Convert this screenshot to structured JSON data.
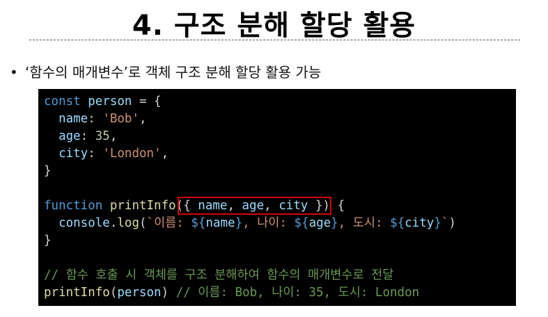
{
  "slide": {
    "title": "4. 구조 분해 할당 활용",
    "bullet": "‘함수의 매개변수’로 객체 구조 분해 할당 활용 가능"
  },
  "code": {
    "l1": {
      "a": "const",
      "b": " ",
      "c": "person",
      "d": " = {"
    },
    "l2": {
      "indent": "  ",
      "key": "name",
      "colon": ": ",
      "val": "'Bob'",
      "end": ","
    },
    "l3": {
      "indent": "  ",
      "key": "age",
      "colon": ": ",
      "val": "35",
      "end": ","
    },
    "l4": {
      "indent": "  ",
      "key": "city",
      "colon": ": ",
      "val": "'London'",
      "end": ","
    },
    "l5": "}",
    "l7": {
      "kw": "function",
      "sp": " ",
      "fn": "printInfo",
      "open": "({ ",
      "p1": "name",
      "c1": ", ",
      "p2": "age",
      "c2": ", ",
      "p3": "city",
      "close": " }) {"
    },
    "l8": {
      "indent": "  ",
      "obj": "console",
      "dot": ".",
      "fn": "log",
      "paren": "(",
      "s1": "`이름: ",
      "i1o": "${",
      "v1": "name",
      "i1c": "}",
      "s2": ", 나이: ",
      "i2o": "${",
      "v2": "age",
      "i2c": "}",
      "s3": ", 도시: ",
      "i3o": "${",
      "v3": "city",
      "i3c": "}",
      "s4": "`",
      "end": ")"
    },
    "l9": "}",
    "l11": "// 함수 호출 시 객체를 구조 분해하여 함수의 매개변수로 전달",
    "l12": {
      "fn": "printInfo",
      "open": "(",
      "arg": "person",
      "close": ")",
      "sp": " ",
      "comment": "// 이름: Bob, 나이: 35, 도시: London"
    }
  },
  "colors": {
    "keyword": "#569cd6",
    "property": "#9cdcfe",
    "string": "#ce9178",
    "number": "#b5cea8",
    "function": "#dcdcaa",
    "comment": "#6a9955",
    "highlight": "#d40000"
  }
}
